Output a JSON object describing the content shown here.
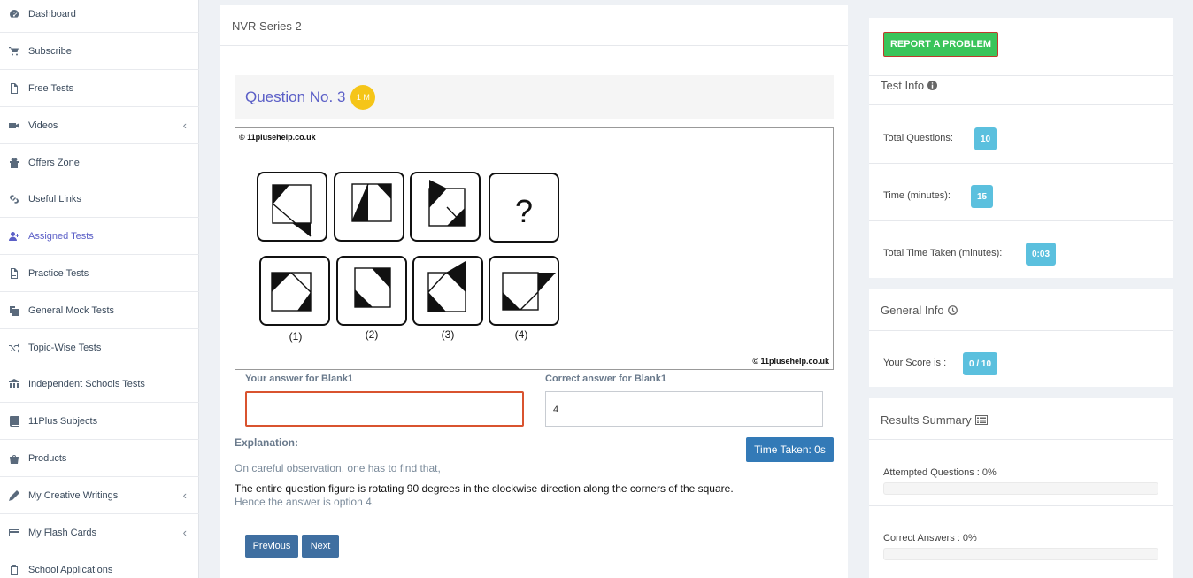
{
  "sidebar": {
    "items": [
      {
        "label": "Dashboard",
        "icon": "dashboard-icon"
      },
      {
        "label": "Subscribe",
        "icon": "cart-icon"
      },
      {
        "label": "Free Tests",
        "icon": "file-icon"
      },
      {
        "label": "Videos",
        "icon": "video-icon",
        "chevron": "‹"
      },
      {
        "label": "Offers Zone",
        "icon": "gift-icon"
      },
      {
        "label": "Useful Links",
        "icon": "link-icon"
      },
      {
        "label": "Assigned Tests",
        "icon": "user-plus-icon"
      },
      {
        "label": "Practice Tests",
        "icon": "file-text-icon"
      },
      {
        "label": "General Mock Tests",
        "icon": "copy-icon"
      },
      {
        "label": "Topic-Wise Tests",
        "icon": "shuffle-icon"
      },
      {
        "label": "Independent Schools Tests",
        "icon": "institution-icon"
      },
      {
        "label": "11Plus Subjects",
        "icon": "book-icon"
      },
      {
        "label": "Products",
        "icon": "shopping-bag-icon"
      },
      {
        "label": "My Creative Writings",
        "icon": "pencil-icon",
        "chevron": "‹"
      },
      {
        "label": "My Flash Cards",
        "icon": "credit-card-icon",
        "chevron": "‹"
      },
      {
        "label": "School Applications",
        "icon": "clipboard-icon"
      }
    ],
    "active_index": 6
  },
  "main": {
    "header": "NVR Series 2",
    "question_title": "Question No. 3",
    "mark_badge": "1 M",
    "image": {
      "copyright_top": "© 11plusehelp.co.uk",
      "copyright_bottom": "© 11plusehelp.co.uk",
      "question_mark": "?",
      "options": [
        "(1)",
        "(2)",
        "(3)",
        "(4)"
      ]
    },
    "your_answer_label": "Your answer for Blank1",
    "your_answer_value": "",
    "correct_answer_label": "Correct answer for Blank1",
    "correct_answer_value": "4",
    "time_taken": "Time Taken: 0s",
    "explanation_label": "Explanation:",
    "explanation_line1": "On careful observation, one has to find that,",
    "explanation_line2": "The entire question figure is rotating 90 degrees in the clockwise direction along  the corners of the square.",
    "explanation_line3": "Hence the answer is option 4.",
    "prev_label": "Previous",
    "next_label": "Next"
  },
  "right": {
    "report_label": "REPORT A PROBLEM",
    "test_info": {
      "title": "Test Info",
      "total_questions_label": "Total Questions:",
      "total_questions": "10",
      "time_label": "Time (minutes):",
      "time": "15",
      "total_time_label": "Total Time Taken (minutes):",
      "total_time": "0:03"
    },
    "general_info": {
      "title": "General Info",
      "score_label": "Your Score is :",
      "score": "0 / 10"
    },
    "results": {
      "title": "Results Summary",
      "attempted_label": "Attempted Questions : 0%",
      "attempted_fraction": 0,
      "correct_label": "Correct Answers : 0%",
      "correct_fraction": 0
    }
  },
  "colors": {
    "accent": "#5b5fc7",
    "badge": "#5bc0de",
    "primary_button": "#337ab7",
    "report_button": "#3ac45a",
    "error_border": "#d9532f"
  }
}
